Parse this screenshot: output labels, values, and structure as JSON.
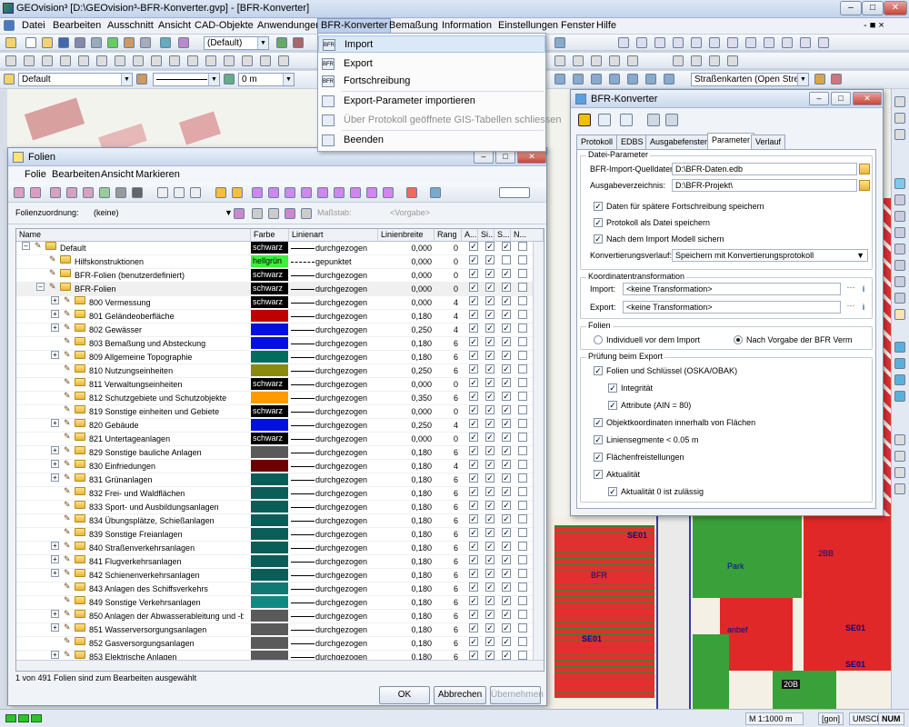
{
  "app": {
    "title": "GEOvision³  [D:\\GEOvision³-BFR-Konverter.gvp] - [BFR-Konverter]"
  },
  "window_controls": {
    "minimize": "–",
    "maximize": "□",
    "close": "✕",
    "mdi": "- ■ ×"
  },
  "menubar": {
    "items": [
      "Datei",
      "Bearbeiten",
      "Ausschnitt",
      "Ansicht",
      "CAD-Objekte",
      "Anwendungen",
      "BFR-Konverter",
      "Bemaßung",
      "Information",
      "Einstellungen",
      "Fenster",
      "Hilfe"
    ]
  },
  "toolbar": {
    "default_combo": "(Default)",
    "layer_combo": "Default",
    "width_combo": "0 m",
    "map_combo": "Straßenkarten (Open Street M"
  },
  "bfr_menu": {
    "items": [
      {
        "label": "Import",
        "enabled": true,
        "icon": "BFR"
      },
      {
        "label": "Export",
        "enabled": true,
        "icon": "BFR"
      },
      {
        "label": "Fortschreibung",
        "enabled": true,
        "icon": "BFR"
      },
      {
        "label": "Export-Parameter importieren",
        "enabled": true,
        "icon": ""
      },
      {
        "label": "Über Protokoll geöffnete GIS-Tabellen schliessen",
        "enabled": false,
        "icon": ""
      },
      {
        "label": "Beenden",
        "enabled": true,
        "icon": ""
      }
    ]
  },
  "folien": {
    "title": "Folien",
    "menu": [
      "Folie",
      "Bearbeiten",
      "Ansicht",
      "Markieren"
    ],
    "zuordnung_label": "Folienzuordnung:",
    "zuordnung_value": "(keine)",
    "massstab_label": "Maßstab:",
    "massstab_value": "<Vorgabe>",
    "columns": [
      "Name",
      "Farbe",
      "Linienart",
      "Linienbreite",
      "Rang",
      "A...",
      "Si...",
      "S...",
      "N..."
    ],
    "rows": [
      {
        "name": "Default",
        "level": 0,
        "exp": "–",
        "color": "schwarz",
        "hex": "#000000",
        "line": "durchgezogen",
        "w": "0,000",
        "rank": "0",
        "c": [
          1,
          1,
          1,
          0
        ]
      },
      {
        "name": "Hilfskonstruktionen",
        "level": 1,
        "exp": "",
        "color": "hellgrün",
        "hex": "#3cf03c",
        "line": "gepunktet",
        "w": "0,000",
        "rank": "0",
        "c": [
          1,
          1,
          0,
          0
        ]
      },
      {
        "name": "BFR-Folien (benutzerdefiniert)",
        "level": 1,
        "exp": "",
        "color": "schwarz",
        "hex": "#000000",
        "line": "durchgezogen",
        "w": "0,000",
        "rank": "0",
        "c": [
          1,
          1,
          1,
          0
        ]
      },
      {
        "name": "BFR-Folien",
        "level": 1,
        "exp": "–",
        "color": "schwarz",
        "hex": "#000000",
        "line": "durchgezogen",
        "w": "0,000",
        "rank": "0",
        "c": [
          1,
          1,
          1,
          0
        ]
      },
      {
        "name": "800 Vermessung",
        "level": 2,
        "exp": "+",
        "color": "schwarz",
        "hex": "#000000",
        "line": "durchgezogen",
        "w": "0,000",
        "rank": "4",
        "c": [
          1,
          1,
          1,
          0
        ]
      },
      {
        "name": "801 Geländeoberfläche",
        "level": 2,
        "exp": "+",
        "color": "",
        "hex": "#c00000",
        "line": "durchgezogen",
        "w": "0,180",
        "rank": "4",
        "c": [
          1,
          1,
          1,
          0
        ]
      },
      {
        "name": "802 Gewässer",
        "level": 2,
        "exp": "+",
        "color": "",
        "hex": "#0010e0",
        "line": "durchgezogen",
        "w": "0,250",
        "rank": "4",
        "c": [
          1,
          1,
          1,
          0
        ]
      },
      {
        "name": "803 Bemaßung und Absteckung",
        "level": 2,
        "exp": "",
        "color": "",
        "hex": "#0010e0",
        "line": "durchgezogen",
        "w": "0,180",
        "rank": "6",
        "c": [
          1,
          1,
          1,
          0
        ]
      },
      {
        "name": "809 Allgemeine Topographie",
        "level": 2,
        "exp": "+",
        "color": "",
        "hex": "#006d5e",
        "line": "durchgezogen",
        "w": "0,180",
        "rank": "6",
        "c": [
          1,
          1,
          1,
          0
        ]
      },
      {
        "name": "810 Nutzungseinheiten",
        "level": 2,
        "exp": "",
        "color": "",
        "hex": "#8a8a10",
        "line": "durchgezogen",
        "w": "0,250",
        "rank": "6",
        "c": [
          1,
          1,
          1,
          0
        ]
      },
      {
        "name": "811 Verwaltungseinheiten",
        "level": 2,
        "exp": "",
        "color": "schwarz",
        "hex": "#000000",
        "line": "durchgezogen",
        "w": "0,000",
        "rank": "0",
        "c": [
          1,
          1,
          1,
          0
        ]
      },
      {
        "name": "812 Schutzgebiete und Schutzobjekte",
        "level": 2,
        "exp": "",
        "color": "",
        "hex": "#ff9a00",
        "line": "durchgezogen",
        "w": "0,350",
        "rank": "6",
        "c": [
          1,
          1,
          1,
          0
        ]
      },
      {
        "name": "819 Sonstige einheiten und Gebiete",
        "level": 2,
        "exp": "",
        "color": "schwarz",
        "hex": "#000000",
        "line": "durchgezogen",
        "w": "0,000",
        "rank": "0",
        "c": [
          1,
          1,
          1,
          0
        ]
      },
      {
        "name": "820 Gebäude",
        "level": 2,
        "exp": "+",
        "color": "",
        "hex": "#0010e0",
        "line": "durchgezogen",
        "w": "0,250",
        "rank": "4",
        "c": [
          1,
          1,
          1,
          0
        ]
      },
      {
        "name": "821 Untertageanlagen",
        "level": 2,
        "exp": "",
        "color": "schwarz",
        "hex": "#000000",
        "line": "durchgezogen",
        "w": "0,000",
        "rank": "0",
        "c": [
          1,
          1,
          1,
          0
        ]
      },
      {
        "name": "829 Sonstige bauliche Anlagen",
        "level": 2,
        "exp": "+",
        "color": "",
        "hex": "#5a5a5a",
        "line": "durchgezogen",
        "w": "0,180",
        "rank": "6",
        "c": [
          1,
          1,
          1,
          0
        ]
      },
      {
        "name": "830 Einfriedungen",
        "level": 2,
        "exp": "+",
        "color": "",
        "hex": "#6d0000",
        "line": "durchgezogen",
        "w": "0,180",
        "rank": "4",
        "c": [
          1,
          1,
          1,
          0
        ]
      },
      {
        "name": "831 Grünanlagen",
        "level": 2,
        "exp": "+",
        "color": "",
        "hex": "#0b5e58",
        "line": "durchgezogen",
        "w": "0,180",
        "rank": "6",
        "c": [
          1,
          1,
          1,
          0
        ]
      },
      {
        "name": "832 Frei- und Waldflächen",
        "level": 2,
        "exp": "",
        "color": "",
        "hex": "#0b5e58",
        "line": "durchgezogen",
        "w": "0,180",
        "rank": "6",
        "c": [
          1,
          1,
          1,
          0
        ]
      },
      {
        "name": "833 Sport- und Ausbildungsanlagen",
        "level": 2,
        "exp": "",
        "color": "",
        "hex": "#0b5e58",
        "line": "durchgezogen",
        "w": "0,180",
        "rank": "6",
        "c": [
          1,
          1,
          1,
          0
        ]
      },
      {
        "name": "834 Übungsplätze, Schießanlagen",
        "level": 2,
        "exp": "",
        "color": "",
        "hex": "#0b5e58",
        "line": "durchgezogen",
        "w": "0,180",
        "rank": "6",
        "c": [
          1,
          1,
          1,
          0
        ]
      },
      {
        "name": "839 Sonstige Freianlagen",
        "level": 2,
        "exp": "",
        "color": "",
        "hex": "#0b5e58",
        "line": "durchgezogen",
        "w": "0,180",
        "rank": "6",
        "c": [
          1,
          1,
          1,
          0
        ]
      },
      {
        "name": "840 Straßenverkehrsanlagen",
        "level": 2,
        "exp": "+",
        "color": "",
        "hex": "#0b5e58",
        "line": "durchgezogen",
        "w": "0,180",
        "rank": "6",
        "c": [
          1,
          1,
          1,
          0
        ]
      },
      {
        "name": "841 Flugverkehrsanlagen",
        "level": 2,
        "exp": "+",
        "color": "",
        "hex": "#0b5e58",
        "line": "durchgezogen",
        "w": "0,180",
        "rank": "6",
        "c": [
          1,
          1,
          1,
          0
        ]
      },
      {
        "name": "842 Schienenverkehrsanlagen",
        "level": 2,
        "exp": "+",
        "color": "",
        "hex": "#0b5e58",
        "line": "durchgezogen",
        "w": "0,180",
        "rank": "6",
        "c": [
          1,
          1,
          1,
          0
        ]
      },
      {
        "name": "843 Anlagen des Schiffsverkehrs",
        "level": 2,
        "exp": "",
        "color": "",
        "hex": "#0f7a72",
        "line": "durchgezogen",
        "w": "0,180",
        "rank": "6",
        "c": [
          1,
          1,
          1,
          0
        ]
      },
      {
        "name": "849 Sonstige Verkehrsanlagen",
        "level": 2,
        "exp": "",
        "color": "",
        "hex": "#0f8a80",
        "line": "durchgezogen",
        "w": "0,180",
        "rank": "6",
        "c": [
          1,
          1,
          1,
          0
        ]
      },
      {
        "name": "850 Anlagen der Abwasserableitung und -beha",
        "level": 2,
        "exp": "+",
        "color": "",
        "hex": "#5a5a5a",
        "line": "durchgezogen",
        "w": "0,180",
        "rank": "6",
        "c": [
          1,
          1,
          1,
          0
        ]
      },
      {
        "name": "851 Wasserversorgungsanlagen",
        "level": 2,
        "exp": "+",
        "color": "",
        "hex": "#5a5a5a",
        "line": "durchgezogen",
        "w": "0,180",
        "rank": "6",
        "c": [
          1,
          1,
          1,
          0
        ]
      },
      {
        "name": "852 Gasversorgungsanlagen",
        "level": 2,
        "exp": "",
        "color": "",
        "hex": "#5a5a5a",
        "line": "durchgezogen",
        "w": "0,180",
        "rank": "6",
        "c": [
          1,
          1,
          1,
          0
        ]
      },
      {
        "name": "853 Elektrische Anlagen",
        "level": 2,
        "exp": "+",
        "color": "",
        "hex": "#5a5a5a",
        "line": "durchgezogen",
        "w": "0,180",
        "rank": "6",
        "c": [
          1,
          1,
          1,
          0
        ]
      }
    ],
    "status": "1 von 491 Folien sind zum Bearbeiten ausgewählt",
    "ok": "OK",
    "cancel": "Abbrechen",
    "apply": "Übernehmen"
  },
  "bfr": {
    "title": "BFR-Konverter",
    "tabs": [
      "Protokoll",
      "EDBS",
      "Ausgabefenster",
      "Parameter",
      "Verlauf"
    ],
    "active_tab": "Parameter",
    "dp": {
      "title": "Datei-Parameter",
      "src_label": "BFR-Import-Quelldaten:",
      "src_value": "D:\\BFR-Daten.edb",
      "out_label": "Ausgabeverzeichnis:",
      "out_value": "D:\\BFR-Projekt\\",
      "c1": "Daten für spätere Fortschreibung speichern",
      "c2": "Protokoll als Datei speichern",
      "c3": "Nach dem Import Modell sichern",
      "kv_label": "Konvertierungsverlauf:",
      "kv_value": "Speichern mit Konvertierungsprotokoll"
    },
    "kt": {
      "title": "Koordinatentransformation",
      "imp_label": "Import:",
      "imp_value": "<keine Transformation>",
      "exp_label": "Export:",
      "exp_value": "<keine Transformation>",
      "dots": "···",
      "info": "i"
    },
    "folien": {
      "title": "Folien",
      "r1": "Individuell vor dem Import",
      "r2": "Nach Vorgabe der BFR Verm"
    },
    "pruef": {
      "title": "Prüfung beim Export",
      "items": [
        {
          "label": "Folien und Schlüssel (OSKA/OBAK)",
          "indent": 0
        },
        {
          "label": "Integrität",
          "indent": 1
        },
        {
          "label": "Attribute (AIN = 80)",
          "indent": 1
        },
        {
          "label": "Objektkoordinaten innerhalb von Flächen",
          "indent": 0
        },
        {
          "label": "Liniensegmente < 0.05 m",
          "indent": 0
        },
        {
          "label": "Flächenfreistellungen",
          "indent": 0
        },
        {
          "label": "Aktualität",
          "indent": 0
        },
        {
          "label": "Aktualität 0 ist zulässig",
          "indent": 1
        }
      ]
    }
  },
  "status": {
    "scale": "M 1:1000  m",
    "gon": "[gon]",
    "umsch": "UMSCH",
    "num": "NUM"
  },
  "map": {
    "labels": [
      "SE01",
      "Park",
      "2BB",
      "SE01",
      "anbef",
      "SE01",
      "20B",
      "SE01",
      "BFR"
    ]
  },
  "check": "✓"
}
